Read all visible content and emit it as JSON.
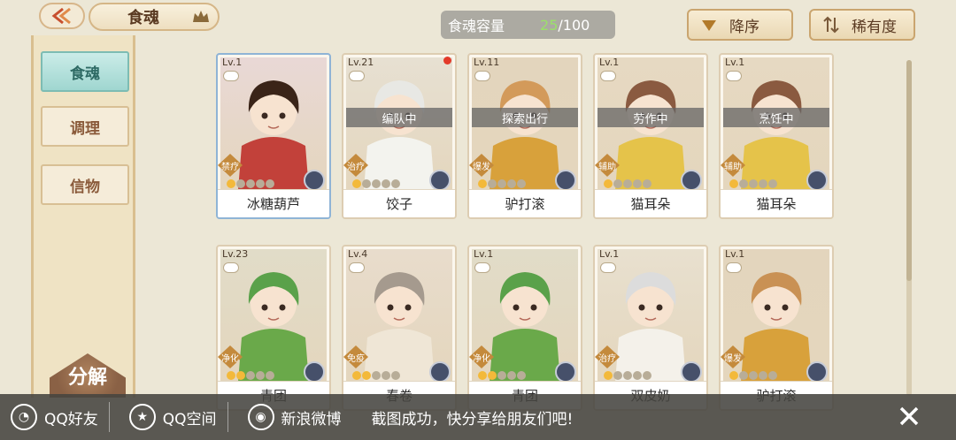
{
  "header": {
    "title": "食魂",
    "capacity_label": "食魂容量",
    "capacity_current": "25",
    "capacity_total": "/100",
    "sort_desc_label": "降序",
    "rarity_label": "稀有度"
  },
  "sidebar": {
    "items": [
      {
        "label": "食魂"
      },
      {
        "label": "调理"
      },
      {
        "label": "信物"
      }
    ],
    "decompose_label": "分解"
  },
  "cards": [
    {
      "level": "Lv.1",
      "name": "冰糖葫芦",
      "role": "禁疗",
      "status": "",
      "rarity": 1,
      "hair": "#3a2418",
      "outfit": "#c2413a",
      "bg": "#e9d8d6"
    },
    {
      "level": "Lv.21",
      "name": "饺子",
      "role": "治疗",
      "status": "编队中",
      "rarity": 1,
      "hair": "#e8e8e4",
      "outfit": "#f3f3ee",
      "bg": "#e7e0d2"
    },
    {
      "level": "Lv.11",
      "name": "驴打滚",
      "role": "爆发",
      "status": "探索出行",
      "rarity": 1,
      "hair": "#d39a5a",
      "outfit": "#d8a13b",
      "bg": "#e3d5bd"
    },
    {
      "level": "Lv.1",
      "name": "猫耳朵",
      "role": "辅助",
      "status": "劳作中",
      "rarity": 1,
      "hair": "#8a5a40",
      "outfit": "#e5c34a",
      "bg": "#e6d9c2"
    },
    {
      "level": "Lv.1",
      "name": "猫耳朵",
      "role": "辅助",
      "status": "烹饪中",
      "rarity": 1,
      "hair": "#8a5a40",
      "outfit": "#e5c34a",
      "bg": "#e6d9c2"
    },
    {
      "level": "Lv.23",
      "name": "青团",
      "role": "净化",
      "status": "",
      "rarity": 2,
      "hair": "#5aa14a",
      "outfit": "#6aa94a",
      "bg": "#e1dcc8"
    },
    {
      "level": "Lv.4",
      "name": "春卷",
      "role": "免疫",
      "status": "",
      "rarity": 2,
      "hair": "#a59a8e",
      "outfit": "#efe6d6",
      "bg": "#e8dccc"
    },
    {
      "level": "Lv.1",
      "name": "青团",
      "role": "净化",
      "status": "",
      "rarity": 2,
      "hair": "#5aa14a",
      "outfit": "#6aa94a",
      "bg": "#e1dcc8"
    },
    {
      "level": "Lv.1",
      "name": "双皮奶",
      "role": "治疗",
      "status": "",
      "rarity": 1,
      "hair": "#dcdcdc",
      "outfit": "#f4f1ea",
      "bg": "#e8e0cf"
    },
    {
      "level": "Lv.1",
      "name": "驴打滚",
      "role": "爆发",
      "status": "",
      "rarity": 1,
      "hair": "#c99154",
      "outfit": "#d8a13b",
      "bg": "#e3d5bd"
    }
  ],
  "sharebar": {
    "qq_friend_label": "QQ好友",
    "qzone_label": "QQ空间",
    "weibo_label": "新浪微博",
    "message": "截图成功，快分享给朋友们吧!"
  },
  "icons": {
    "back": "back-arrow-icon",
    "crown": "crown-icon",
    "sort": "triangle-down-icon",
    "rarity": "rarity-sort-icon",
    "close": "close-icon"
  }
}
